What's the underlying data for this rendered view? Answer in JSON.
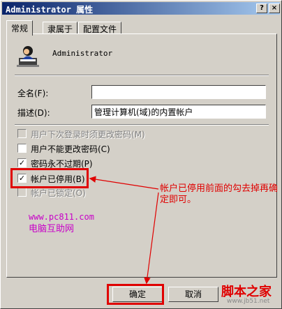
{
  "window": {
    "title": "Administrator 属性",
    "help_glyph": "?",
    "close_glyph": "×"
  },
  "tabs": [
    {
      "label": "常规"
    },
    {
      "label": "隶属于"
    },
    {
      "label": "配置文件"
    }
  ],
  "user": {
    "name": "Administrator",
    "icon": "user-icon"
  },
  "fields": {
    "fullname": {
      "label": "全名(F):",
      "value": ""
    },
    "description": {
      "label": "描述(D):",
      "value": "管理计算机(域)的内置帐户"
    }
  },
  "checkboxes": [
    {
      "label": "用户下次登录时须更改密码(M)",
      "checked": false,
      "disabled": true
    },
    {
      "label": "用户不能更改密码(C)",
      "checked": false,
      "disabled": false
    },
    {
      "label": "密码永不过期(P)",
      "checked": true,
      "disabled": false
    },
    {
      "label": "帐户已停用(B)",
      "checked": true,
      "disabled": false
    },
    {
      "label": "帐户已锁定(O)",
      "checked": false,
      "disabled": true
    }
  ],
  "annotation": {
    "text": "帐户已停用前面的勾去掉再确定即可。"
  },
  "watermark": {
    "url": "www.pc811.com",
    "name": "电脑互助网"
  },
  "buttons": {
    "ok": "确定",
    "cancel": "取消"
  },
  "site_logo": {
    "name": "脚本之家",
    "url": "www.jb51.net"
  },
  "colors": {
    "dialog_bg": "#d4d0c8",
    "title_start": "#0a246a",
    "title_end": "#a6caf0",
    "highlight": "#e00000",
    "watermark": "#c800c8"
  }
}
